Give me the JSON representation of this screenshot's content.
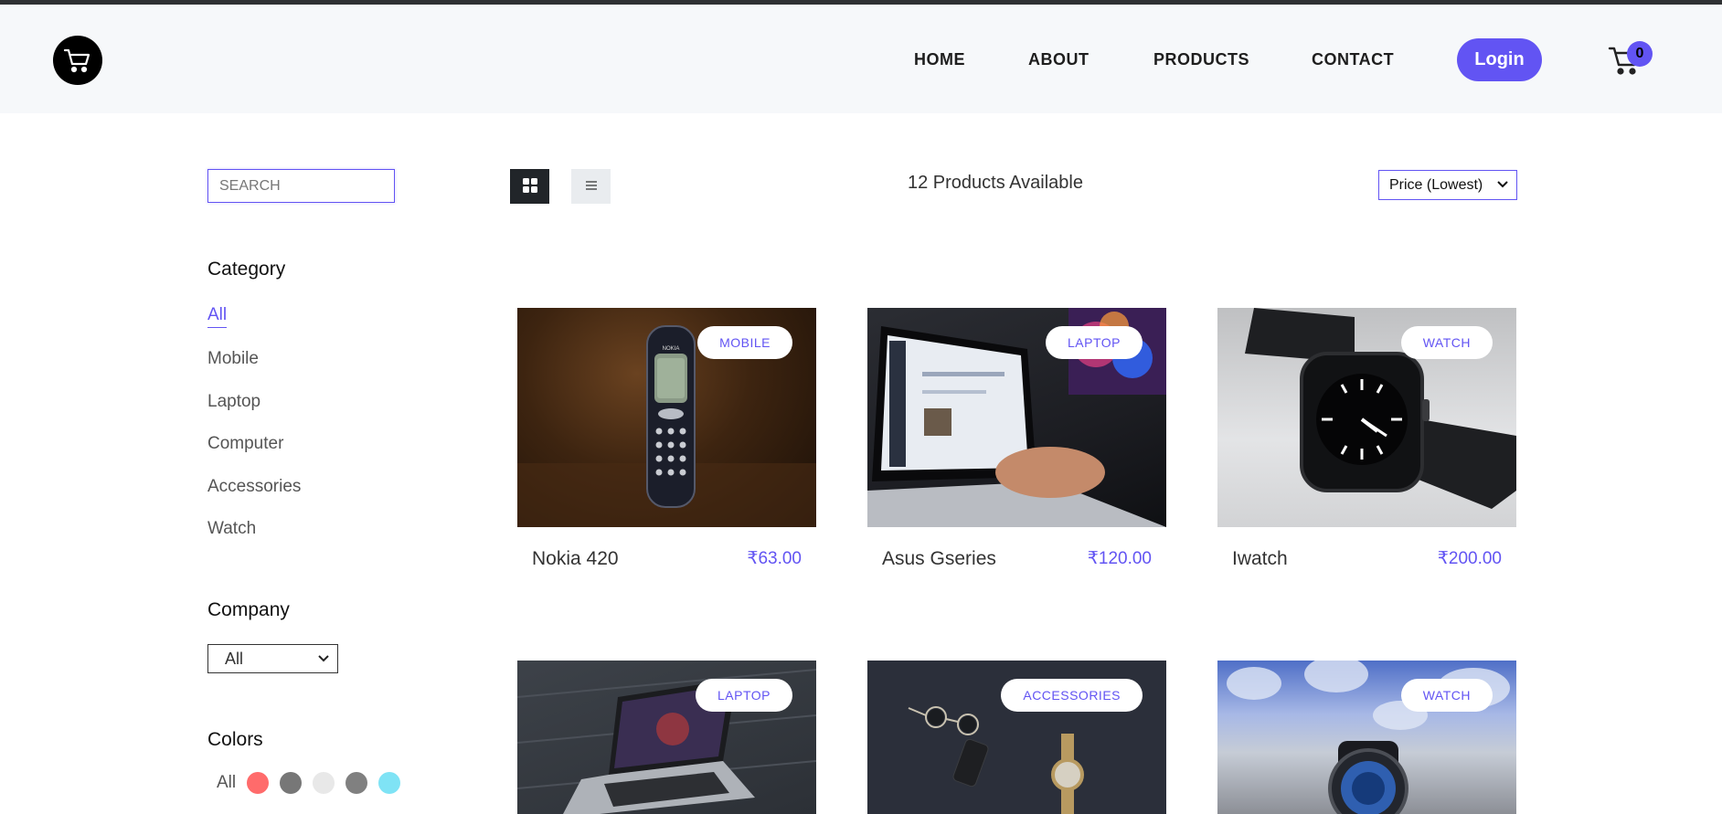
{
  "header": {
    "logo_icon": "shopping-cart-icon",
    "nav": [
      "HOME",
      "ABOUT",
      "PRODUCTS",
      "CONTACT"
    ],
    "login_label": "Login",
    "cart_icon": "cart-icon",
    "cart_count": "0",
    "accent": "#6254f3"
  },
  "sidebar": {
    "search_placeholder": "SEARCH",
    "category_heading": "Category",
    "categories": [
      "All",
      "Mobile",
      "Laptop",
      "Computer",
      "Accessories",
      "Watch"
    ],
    "active_category": "All",
    "company_heading": "Company",
    "company_selected": "All",
    "colors_heading": "Colors",
    "colors_all_label": "All",
    "colors": [
      "#ff6b6b",
      "#777777",
      "#e8e8e8",
      "#808080",
      "#7fe3f5"
    ]
  },
  "toolbar": {
    "grid_icon": "grid-icon",
    "list_icon": "list-icon",
    "product_count": "12 Products Available",
    "sort_selected": "Price (Lowest)"
  },
  "products": [
    {
      "name": "Nokia 420",
      "price": "₹63.00",
      "category": "MOBILE"
    },
    {
      "name": "Asus Gseries",
      "price": "₹120.00",
      "category": "LAPTOP"
    },
    {
      "name": "Iwatch",
      "price": "₹200.00",
      "category": "WATCH"
    },
    {
      "category": "LAPTOP"
    },
    {
      "category": "ACCESSORIES"
    },
    {
      "category": "WATCH"
    }
  ]
}
